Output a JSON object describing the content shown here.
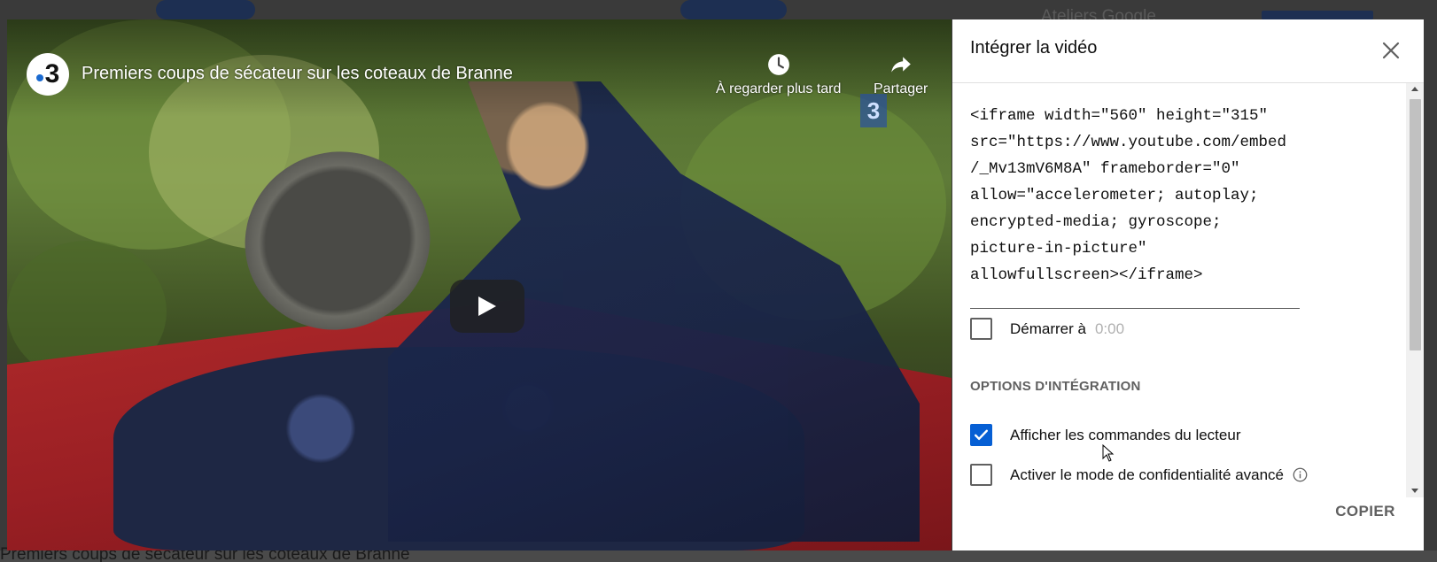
{
  "background_page": {
    "header_channel_text": "Ateliers Google",
    "below_video_title": "Premiers coups de sécateur sur les coteaux de Branne"
  },
  "video": {
    "channel_logo": {
      "number": "3",
      "icon": "france3-logo"
    },
    "title": "Premiers coups de sécateur sur les coteaux de Branne",
    "actions": {
      "watch_later": {
        "label": "À regarder plus tard",
        "icon": "clock-icon"
      },
      "share": {
        "label": "Partager",
        "icon": "share-arrow-icon"
      }
    },
    "watermark": "3",
    "play_icon": "play-icon"
  },
  "modal": {
    "title": "Intégrer la vidéo",
    "close_icon": "close-icon",
    "embed_code": "<iframe width=\"560\" height=\"315\"\nsrc=\"https://www.youtube.com/embed\n/_Mv13mV6M8A\" frameborder=\"0\"\nallow=\"accelerometer; autoplay;\nencrypted-media; gyroscope;\npicture-in-picture\"\nallowfullscreen></iframe>",
    "start_at": {
      "label": "Démarrer à",
      "value": "0:00",
      "checked": false
    },
    "options_heading": "OPTIONS D'INTÉGRATION",
    "options": {
      "show_controls": {
        "label": "Afficher les commandes du lecteur",
        "checked": true
      },
      "privacy_mode": {
        "label": "Activer le mode de confidentialité avancé",
        "checked": false,
        "info_icon": "info-icon"
      }
    },
    "copy_label": "COPIER"
  },
  "colors": {
    "accent_blue": "#065fd4",
    "text_primary": "#0f0f0f",
    "text_secondary": "#606060",
    "placeholder": "#b0b0b0"
  }
}
